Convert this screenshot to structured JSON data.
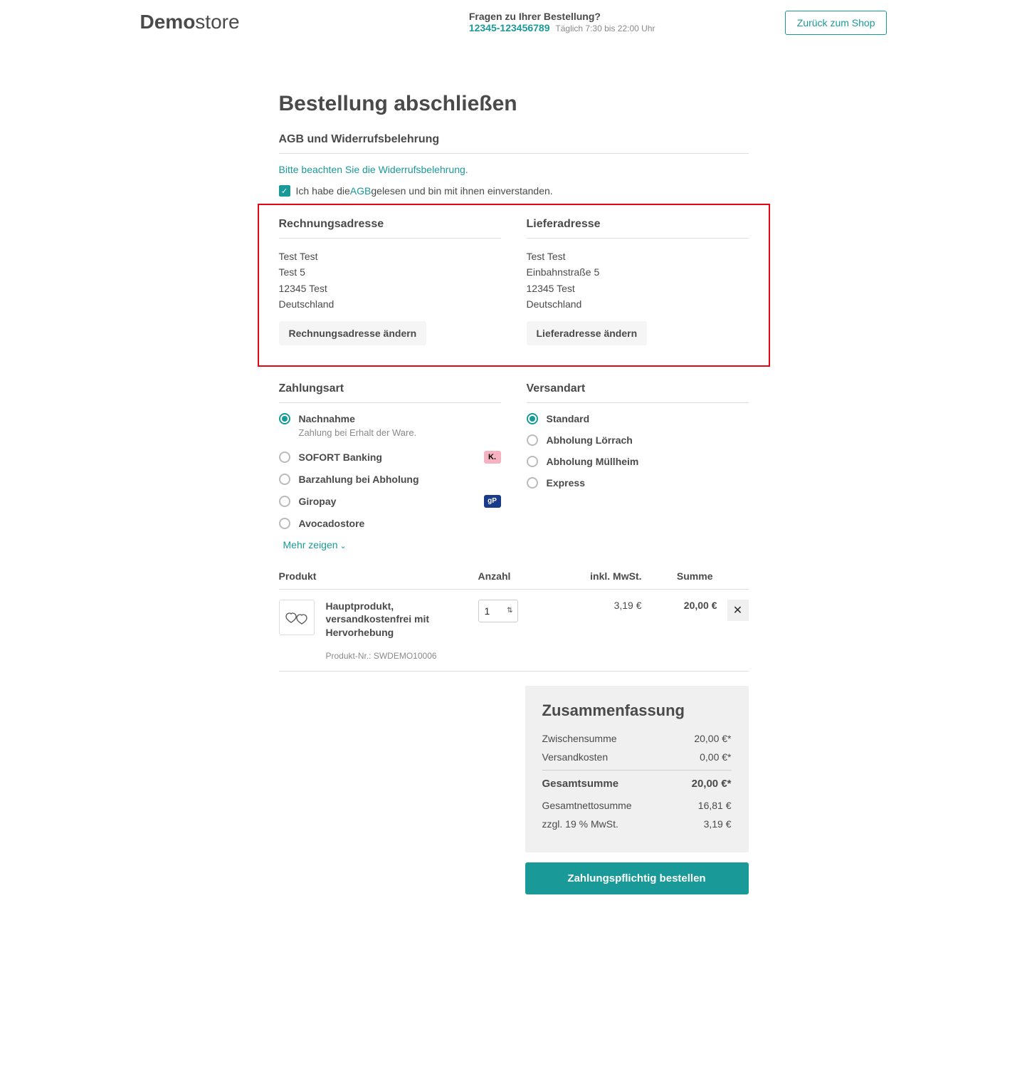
{
  "header": {
    "logo_bold": "Demo",
    "logo_light": "store",
    "help_title": "Fragen zu Ihrer Bestellung?",
    "help_phone": "12345-123456789",
    "help_hours": "Täglich 7:30 bis 22:00 Uhr",
    "back_button": "Zurück zum Shop"
  },
  "page_title": "Bestellung abschließen",
  "terms": {
    "section_title": "AGB und Widerrufsbelehrung",
    "notice": "Bitte beachten Sie die Widerrufsbelehrung.",
    "checkbox_pre": "Ich habe die ",
    "checkbox_link": "AGB",
    "checkbox_post": " gelesen und bin mit ihnen einverstanden."
  },
  "billing": {
    "title": "Rechnungsadresse",
    "lines": [
      "Test Test",
      "Test 5",
      "12345 Test",
      "Deutschland"
    ],
    "change_btn": "Rechnungsadresse ändern"
  },
  "shipping": {
    "title": "Lieferadresse",
    "lines": [
      "Test Test",
      "Einbahnstraße 5",
      "12345 Test",
      "Deutschland"
    ],
    "change_btn": "Lieferadresse ändern"
  },
  "payment": {
    "title": "Zahlungsart",
    "options": [
      {
        "label": "Nachnahme",
        "sub": "Zahlung bei Erhalt der Ware.",
        "checked": true,
        "badge": null
      },
      {
        "label": "SOFORT Banking",
        "checked": false,
        "badge": "K.",
        "badge_class": "pink"
      },
      {
        "label": "Barzahlung bei Abholung",
        "checked": false
      },
      {
        "label": "Giropay",
        "checked": false,
        "badge": "gP",
        "badge_class": "blue"
      },
      {
        "label": "Avocadostore",
        "checked": false
      }
    ],
    "show_more": "Mehr zeigen"
  },
  "delivery": {
    "title": "Versandart",
    "options": [
      {
        "label": "Standard",
        "checked": true
      },
      {
        "label": "Abholung Lörrach",
        "checked": false
      },
      {
        "label": "Abholung Müllheim",
        "checked": false
      },
      {
        "label": "Express",
        "checked": false
      }
    ]
  },
  "products": {
    "col_product": "Produkt",
    "col_qty": "Anzahl",
    "col_tax": "inkl. MwSt.",
    "col_sum": "Summe",
    "items": [
      {
        "name": "Hauptprodukt, versandkostenfrei mit Hervorhebung",
        "sku": "Produkt-Nr.: SWDEMO10006",
        "qty": "1",
        "tax": "3,19 €",
        "sum": "20,00 €"
      }
    ]
  },
  "summary": {
    "title": "Zusammenfassung",
    "subtotal_label": "Zwischensumme",
    "subtotal_value": "20,00 €*",
    "shipping_label": "Versandkosten",
    "shipping_value": "0,00 €*",
    "total_label": "Gesamtsumme",
    "total_value": "20,00 €*",
    "net_label": "Gesamtnettosumme",
    "net_value": "16,81 €",
    "vat_label": "zzgl. 19 % MwSt.",
    "vat_value": "3,19 €"
  },
  "order_button": "Zahlungspflichtig bestellen"
}
